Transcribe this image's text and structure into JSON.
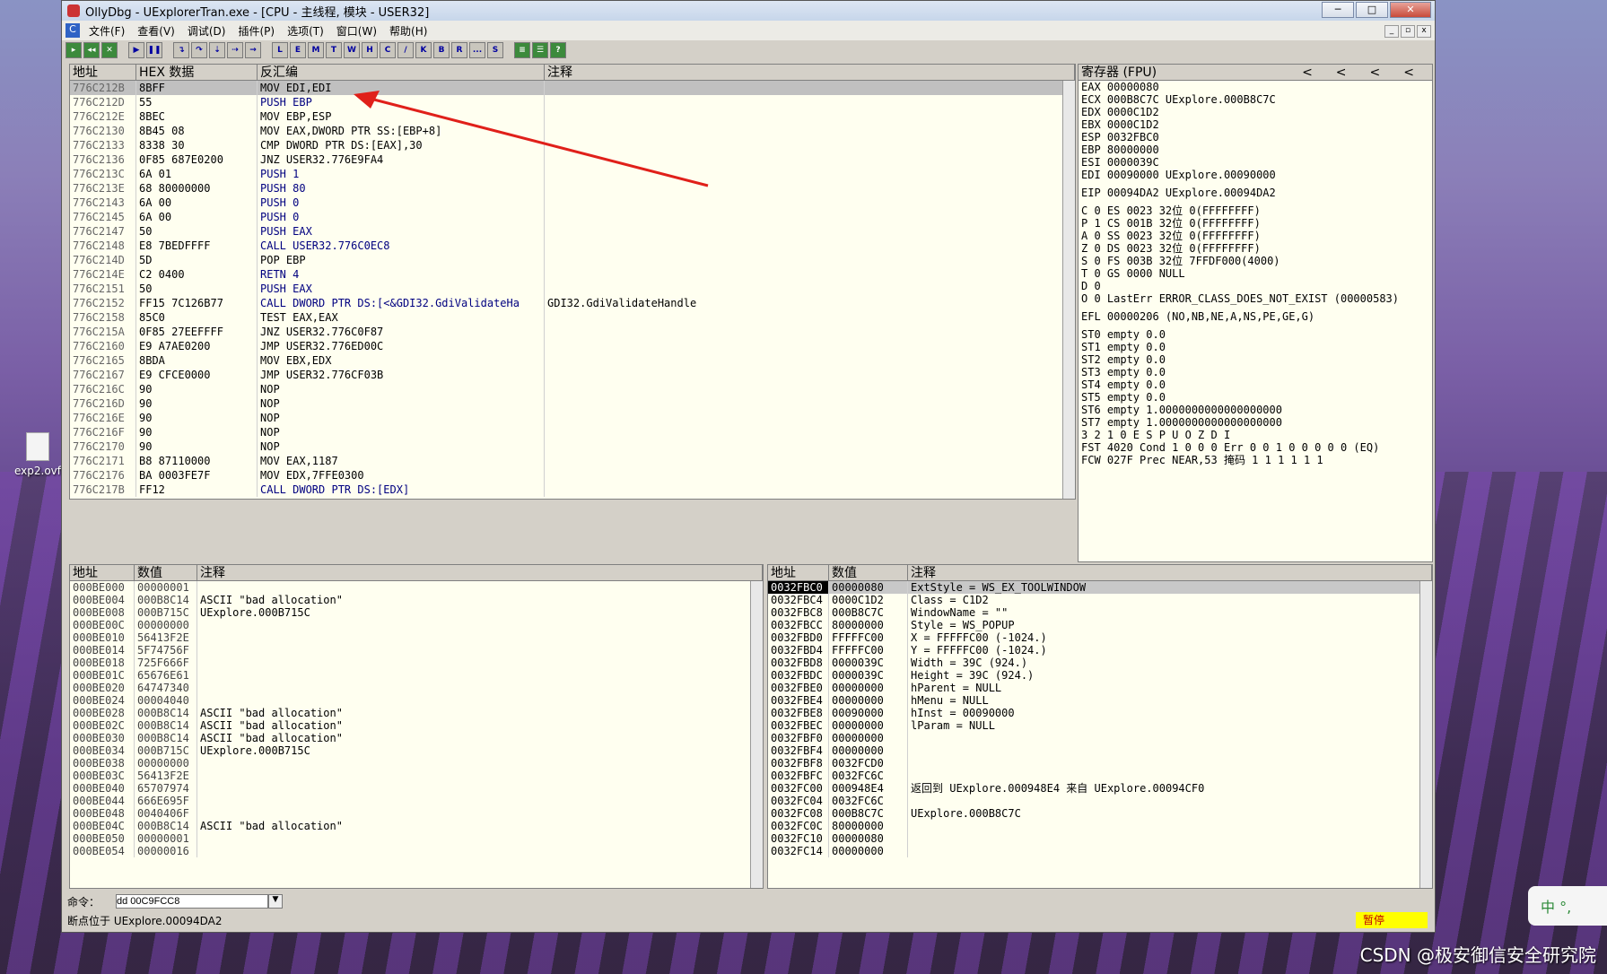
{
  "window": {
    "title": "OllyDbg - UExplorerTran.exe - [CPU - 主线程, 模块 - USER32]"
  },
  "menu": [
    "文件(F)",
    "查看(V)",
    "调试(D)",
    "插件(P)",
    "选项(T)",
    "窗口(W)",
    "帮助(H)"
  ],
  "toolbar_letters": [
    "L",
    "E",
    "M",
    "T",
    "W",
    "H",
    "C",
    "/",
    "K",
    "B",
    "R",
    "...",
    "S"
  ],
  "desktop": {
    "icon_label": "exp2.ovf",
    "watermark": "CSDN @极安御信安全研究院",
    "ime": "中 °,"
  },
  "disasm": {
    "headers": [
      "地址",
      "HEX 数据",
      "反汇编",
      "注释"
    ],
    "rows": [
      [
        "776C212B",
        "8BFF",
        "MOV EDI,EDI",
        ""
      ],
      [
        "776C212D",
        "55",
        "PUSH EBP",
        ""
      ],
      [
        "776C212E",
        "8BEC",
        "MOV EBP,ESP",
        ""
      ],
      [
        "776C2130",
        "8B45 08",
        "MOV EAX,DWORD PTR SS:[EBP+8]",
        ""
      ],
      [
        "776C2133",
        "8338 30",
        "CMP DWORD PTR DS:[EAX],30",
        ""
      ],
      [
        "776C2136",
        "0F85 687E0200",
        "JNZ USER32.776E9FA4",
        ""
      ],
      [
        "776C213C",
        "6A 01",
        "PUSH 1",
        ""
      ],
      [
        "776C213E",
        "68 80000000",
        "PUSH 80",
        ""
      ],
      [
        "776C2143",
        "6A 00",
        "PUSH 0",
        ""
      ],
      [
        "776C2145",
        "6A 00",
        "PUSH 0",
        ""
      ],
      [
        "776C2147",
        "50",
        "PUSH EAX",
        ""
      ],
      [
        "776C2148",
        "E8 7BEDFFFF",
        "CALL USER32.776C0EC8",
        ""
      ],
      [
        "776C214D",
        "5D",
        "POP EBP",
        ""
      ],
      [
        "776C214E",
        "C2 0400",
        "RETN 4",
        ""
      ],
      [
        "776C2151",
        "50",
        "PUSH EAX",
        ""
      ],
      [
        "776C2152",
        "FF15 7C126B77",
        "CALL DWORD PTR DS:[<&GDI32.GdiValidateHa",
        "GDI32.GdiValidateHandle"
      ],
      [
        "776C2158",
        "85C0",
        "TEST EAX,EAX",
        ""
      ],
      [
        "776C215A",
        "0F85 27EEFFFF",
        "JNZ USER32.776C0F87",
        ""
      ],
      [
        "776C2160",
        "E9 A7AE0200",
        "JMP USER32.776ED00C",
        ""
      ],
      [
        "776C2165",
        "8BDA",
        "MOV EBX,EDX",
        ""
      ],
      [
        "776C2167",
        "E9 CFCE0000",
        "JMP USER32.776CF03B",
        ""
      ],
      [
        "776C216C",
        "90",
        "NOP",
        ""
      ],
      [
        "776C216D",
        "90",
        "NOP",
        ""
      ],
      [
        "776C216E",
        "90",
        "NOP",
        ""
      ],
      [
        "776C216F",
        "90",
        "NOP",
        ""
      ],
      [
        "776C2170",
        "90",
        "NOP",
        ""
      ],
      [
        "776C2171",
        "B8 87110000",
        "MOV EAX,1187",
        ""
      ],
      [
        "776C2176",
        "BA 0003FE7F",
        "MOV EDX,7FFE0300",
        ""
      ],
      [
        "776C217B",
        "FF12",
        "CALL DWORD PTR DS:[EDX]",
        ""
      ]
    ]
  },
  "registers": {
    "title": "寄存器 (FPU)",
    "nav": [
      "<",
      "<",
      "<",
      "<"
    ],
    "lines": [
      "EAX 00000080",
      "ECX 000B8C7C UExplore.000B8C7C",
      "EDX 0000C1D2",
      "EBX 0000C1D2",
      "ESP 0032FBC0",
      "EBP 80000000",
      "ESI 0000039C",
      "EDI 00090000 UExplore.00090000",
      "",
      "EIP 00094DA2 UExplore.00094DA2",
      "",
      "C 0  ES 0023 32位 0(FFFFFFFF)",
      "P 1  CS 001B 32位 0(FFFFFFFF)",
      "A 0  SS 0023 32位 0(FFFFFFFF)",
      "Z 0  DS 0023 32位 0(FFFFFFFF)",
      "S 0  FS 003B 32位 7FFDF000(4000)",
      "T 0  GS 0000 NULL",
      "D 0",
      "O 0  LastErr ERROR_CLASS_DOES_NOT_EXIST (00000583)",
      "",
      "EFL 00000206 (NO,NB,NE,A,NS,PE,GE,G)",
      "",
      "ST0 empty 0.0",
      "ST1 empty 0.0",
      "ST2 empty 0.0",
      "ST3 empty 0.0",
      "ST4 empty 0.0",
      "ST5 empty 0.0",
      "ST6 empty 1.0000000000000000000",
      "ST7 empty 1.0000000000000000000",
      "               3 2 1 0      E S P U O Z D I",
      "FST 4020  Cond 1 0 0 0  Err 0 0 1 0 0 0 0 0  (EQ)",
      "FCW 027F  Prec NEAR,53  掩码    1 1 1 1 1 1"
    ]
  },
  "dump": {
    "headers": [
      "地址",
      "数值",
      "注释"
    ],
    "rows": [
      [
        "000BE000",
        "00000001",
        ""
      ],
      [
        "000BE004",
        "000B8C14",
        "ASCII \"bad allocation\""
      ],
      [
        "000BE008",
        "000B715C",
        "UExplore.000B715C"
      ],
      [
        "000BE00C",
        "00000000",
        ""
      ],
      [
        "000BE010",
        "56413F2E",
        ""
      ],
      [
        "000BE014",
        "5F74756F",
        ""
      ],
      [
        "000BE018",
        "725F666F",
        ""
      ],
      [
        "000BE01C",
        "65676E61",
        ""
      ],
      [
        "000BE020",
        "64747340",
        ""
      ],
      [
        "000BE024",
        "00004040",
        ""
      ],
      [
        "000BE028",
        "000B8C14",
        "ASCII \"bad allocation\""
      ],
      [
        "000BE02C",
        "000B8C14",
        "ASCII \"bad allocation\""
      ],
      [
        "000BE030",
        "000B8C14",
        "ASCII \"bad allocation\""
      ],
      [
        "000BE034",
        "000B715C",
        "UExplore.000B715C"
      ],
      [
        "000BE038",
        "00000000",
        ""
      ],
      [
        "000BE03C",
        "56413F2E",
        ""
      ],
      [
        "000BE040",
        "65707974",
        ""
      ],
      [
        "000BE044",
        "666E695F",
        ""
      ],
      [
        "000BE048",
        "0040406F",
        ""
      ],
      [
        "000BE04C",
        "000B8C14",
        "ASCII \"bad allocation\""
      ],
      [
        "000BE050",
        "00000001",
        ""
      ],
      [
        "000BE054",
        "00000016",
        ""
      ]
    ]
  },
  "stack": {
    "headers": [
      "地址",
      "数值",
      "注释"
    ],
    "rows": [
      [
        "0032FBC0",
        "00000080",
        "ExtStyle = WS_EX_TOOLWINDOW"
      ],
      [
        "0032FBC4",
        "0000C1D2",
        "Class = C1D2"
      ],
      [
        "0032FBC8",
        "000B8C7C",
        "WindowName = \"\""
      ],
      [
        "0032FBCC",
        "80000000",
        "Style = WS_POPUP"
      ],
      [
        "0032FBD0",
        "FFFFFC00",
        "X = FFFFFC00 (-1024.)"
      ],
      [
        "0032FBD4",
        "FFFFFC00",
        "Y = FFFFFC00 (-1024.)"
      ],
      [
        "0032FBD8",
        "0000039C",
        "Width = 39C (924.)"
      ],
      [
        "0032FBDC",
        "0000039C",
        "Height = 39C (924.)"
      ],
      [
        "0032FBE0",
        "00000000",
        "hParent = NULL"
      ],
      [
        "0032FBE4",
        "00000000",
        "hMenu = NULL"
      ],
      [
        "0032FBE8",
        "00090000",
        "hInst = 00090000"
      ],
      [
        "0032FBEC",
        "00000000",
        "lParam = NULL"
      ],
      [
        "0032FBF0",
        "00000000",
        ""
      ],
      [
        "0032FBF4",
        "00000000",
        ""
      ],
      [
        "0032FBF8",
        "0032FCD0",
        ""
      ],
      [
        "0032FBFC",
        "0032FC6C",
        ""
      ],
      [
        "0032FC00",
        "000948E4",
        "返回到 UExplore.000948E4 来自 UExplore.00094CF0"
      ],
      [
        "0032FC04",
        "0032FC6C",
        ""
      ],
      [
        "0032FC08",
        "000B8C7C",
        "UExplore.000B8C7C"
      ],
      [
        "0032FC0C",
        "80000000",
        ""
      ],
      [
        "0032FC10",
        "00000080",
        ""
      ],
      [
        "0032FC14",
        "00000000",
        ""
      ]
    ]
  },
  "command": {
    "label": "命令：",
    "value": "dd 00C9FCC8"
  },
  "status": {
    "text": "断点位于 UExplore.00094DA2",
    "state": "暂停"
  }
}
